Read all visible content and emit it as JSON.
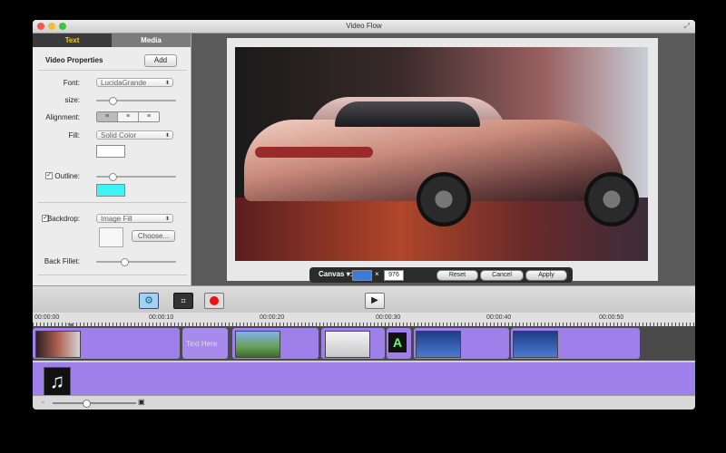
{
  "window": {
    "title": "Video Flow"
  },
  "sidebar": {
    "tabs": [
      {
        "label": "Text"
      },
      {
        "label": "Media"
      }
    ],
    "section_title": "Video Properties",
    "add_label": "Add",
    "font_label": "Font:",
    "font_value": "LucidaGrande",
    "size_label": "size:",
    "size_level": 0.2,
    "alignment_label": "Alignment:",
    "fill_label": "Fill:",
    "fill_value": "Solid Color",
    "fill_color": "#ffffff",
    "outline_label": "Outline:",
    "outline_checked": true,
    "outline_level": 0.2,
    "outline_color": "#3ef3f4",
    "backdrop_label": "Backdrop:",
    "backdrop_checked": true,
    "backdrop_value": "Image Fill",
    "choose_label": "Choose...",
    "back_fillet_label": "Back Fillet:",
    "back_fillet_level": 0.35
  },
  "canvas": {
    "label": "Canvas",
    "width": "1280",
    "height": "976",
    "times": "×",
    "reset_label": "Reset",
    "cancel_label": "Cancel",
    "apply_label": "Apply"
  },
  "toolbar": {
    "gear": "⚙",
    "crop": "⌗",
    "play": "▶"
  },
  "timeline": {
    "ticks": [
      "00:00:00",
      "00:00:10",
      "00:00:20",
      "00:00:30",
      "00:00:40",
      "00:00:50"
    ],
    "text_clip_label": "Text Here",
    "title_clip_letter": "A",
    "music_glyph": "♫"
  },
  "zoom": {
    "level": 0.4
  },
  "colors": {
    "accent_tab": "#f2d200",
    "clip": "#9f80ea"
  }
}
